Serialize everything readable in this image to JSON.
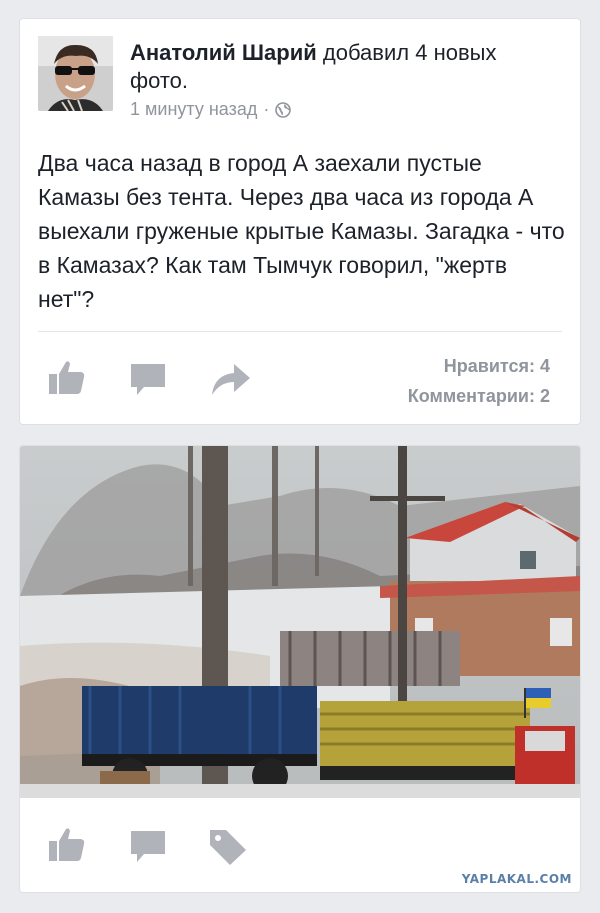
{
  "post": {
    "author": "Анатолий Шарий",
    "action": "добавил 4 новых фото.",
    "time": "1 минуту назад",
    "separator": "·",
    "privacy_icon": "globe-icon",
    "text": "Два часа назад в город А заехали пустые Камазы без тента. Через два часа из города А выехали груженые крытые Камазы. Загадка - что в Камазах? Как там Тымчук говорил, \"жертв нет\"?",
    "actions": [
      "like-icon",
      "comment-icon",
      "share-icon"
    ],
    "likes_label": "Нравится: 4",
    "comments_label": "Комментарии: 2"
  },
  "photo_post": {
    "actions": [
      "like-icon",
      "comment-icon",
      "tag-icon"
    ]
  },
  "watermark": "YAPLAKAL.COM",
  "colors": {
    "background": "#e9ebee",
    "card": "#ffffff",
    "meta_text": "#90949c",
    "icon_gray": "#b0b4ba",
    "watermark": "#5a7fa8"
  }
}
